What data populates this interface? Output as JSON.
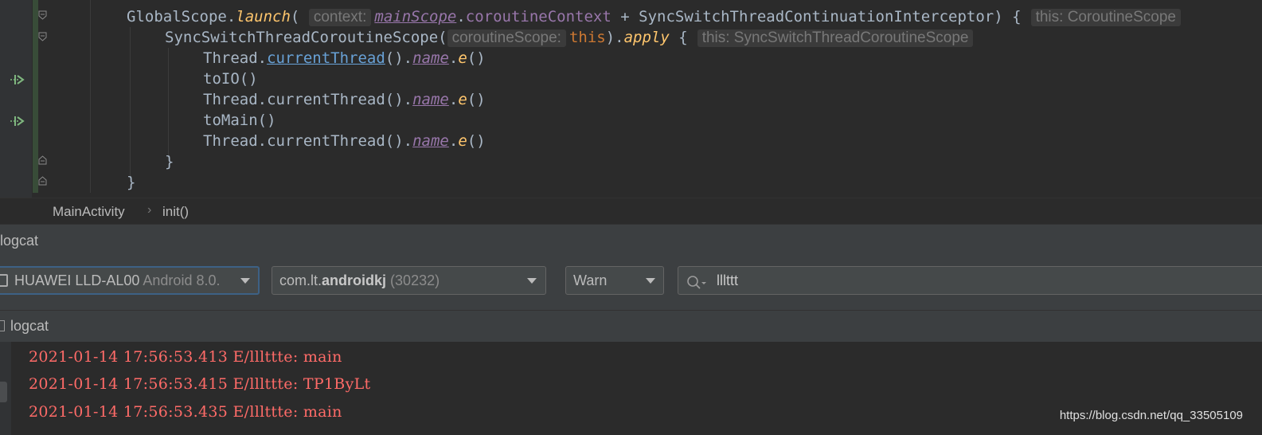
{
  "colors": {
    "editor_bg": "#2b2b2b",
    "panel_bg": "#3c3f41",
    "error_log": "#ff6b68",
    "keyword": "#cc7832",
    "function_call": "#ffc66d",
    "property": "#9876aa"
  },
  "editor": {
    "lines": {
      "l1": {
        "a": "GlobalScope.",
        "launch": "launch",
        "paren": "(",
        "hint": "context:",
        "mainScope": "mainScope",
        "dot": ".",
        "coroutineContext": "coroutineContext",
        "rest": " + SyncSwitchThreadContinuationInterceptor) {",
        "end_hint": "this: CoroutineScope"
      },
      "l2": {
        "a": "SyncSwitchThreadCoroutineScope(",
        "hint": "coroutineScope:",
        "this_kw": "this",
        "b": ").",
        "apply": "apply",
        "c": " {",
        "end_hint": "this: SyncSwitchThreadCoroutineScope"
      },
      "l3": {
        "a": "Thread.",
        "currentThread": "currentThread",
        "b": "().",
        "name": "name",
        "dot": ".",
        "e": "e",
        "c": "()"
      },
      "l4": {
        "text": "toIO()"
      },
      "l5": {
        "a": "Thread.currentThread().",
        "name": "name",
        "dot": ".",
        "e": "e",
        "c": "()"
      },
      "l6": {
        "text": "toMain()"
      },
      "l7": {
        "a": "Thread.currentThread().",
        "name": "name",
        "dot": ".",
        "e": "e",
        "c": "()"
      },
      "l8": {
        "text": "}"
      },
      "l9": {
        "text": "}"
      }
    },
    "gutter_icons": [
      "suspend-call-icon",
      "suspend-call-icon"
    ]
  },
  "breadcrumb": {
    "items": [
      "MainActivity",
      "init()"
    ],
    "separator": "›"
  },
  "logcat": {
    "title": "logcat",
    "device": {
      "name": "HUAWEI LLD-AL00",
      "os": "Android 8.0."
    },
    "process": {
      "prefix": "com.lt.",
      "bold": "androidkj",
      "pid": "(30232)"
    },
    "level": "Warn",
    "search": {
      "value": "lllttt"
    },
    "subtitle": "logcat",
    "entries": [
      "2021-01-14 17:56:53.413 E/lllttte: main",
      "2021-01-14 17:56:53.415 E/lllttte: TP1ByLt",
      "2021-01-14 17:56:53.435 E/lllttte: main"
    ]
  },
  "watermark": "https://blog.csdn.net/qq_33505109"
}
